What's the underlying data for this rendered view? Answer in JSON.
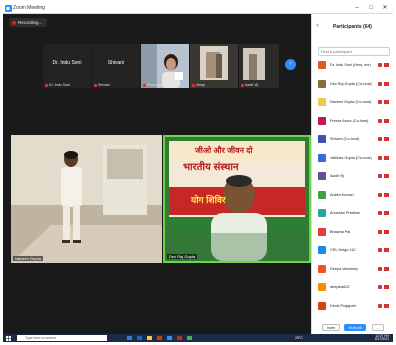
{
  "window": {
    "title": "Zoom Meeting",
    "minimize": "–",
    "maximize": "□",
    "close": "✕"
  },
  "recording": {
    "label": "Recording..."
  },
  "thumbnails": [
    {
      "name": "Dr. Indu Soni",
      "caption": "Dr. Indu Soni"
    },
    {
      "name": "Shivani",
      "caption": "Shivani"
    },
    {
      "name": "",
      "caption": "Prerna Anura..."
    },
    {
      "name": "",
      "caption": "Vinay"
    },
    {
      "name": "",
      "caption": "Aadit Vij"
    }
  ],
  "next_page": "›",
  "videos": {
    "left_caption": "Naveen Gupta",
    "right_caption": "Dev Raj Gupta",
    "banner_line1": "जीओ और जीवन दो",
    "banner_line2": "भारतीय संस्थान",
    "banner_line3": "योग शिविर"
  },
  "panel": {
    "title": "Participants (64)",
    "collapse": "˅",
    "search_placeholder": "Find a participant",
    "participants": [
      {
        "name": "Dr. Indu Soni (Host, me)",
        "color": "#e05a1e"
      },
      {
        "name": "Dev Raj Gupta (Co-host)",
        "color": "#8a6d3b"
      },
      {
        "name": "Naveen Gupta (Co-host)",
        "color": "#f2c94c"
      },
      {
        "name": "Prerna Arora (Co-host)",
        "color": "#c2185b"
      },
      {
        "name": "Shivani (Co-host)",
        "color": "#3f51b5"
      },
      {
        "name": "Vaibhav Gupta (Co-host)",
        "color": "#2d6cdf"
      },
      {
        "name": "Aadit Vij",
        "color": "#6a4c93"
      },
      {
        "name": "Ankita Kumari",
        "color": "#43a047"
      },
      {
        "name": "Anushka Pradhan",
        "color": "#26a69a"
      },
      {
        "name": "Bhawna Pal",
        "color": "#e53935"
      },
      {
        "name": "CRL Delgo 112",
        "color": "#1e88e5"
      },
      {
        "name": "Deepa Varshney",
        "color": "#f4511e"
      },
      {
        "name": "deepika622",
        "color": "#fb8c00"
      },
      {
        "name": "Devki Prajapati",
        "color": "#d84315"
      }
    ],
    "footer": {
      "invite": "Invite",
      "mute_all": "Mute All",
      "more": "..."
    }
  },
  "taskbar": {
    "search_placeholder": "Type here to search",
    "temp": "25°C",
    "time": "12:07 PM",
    "date": "6/17/2021"
  },
  "colors": {
    "accent": "#2d8cff",
    "active_speaker": "#6fd34b",
    "mic_muted": "#d33333"
  }
}
